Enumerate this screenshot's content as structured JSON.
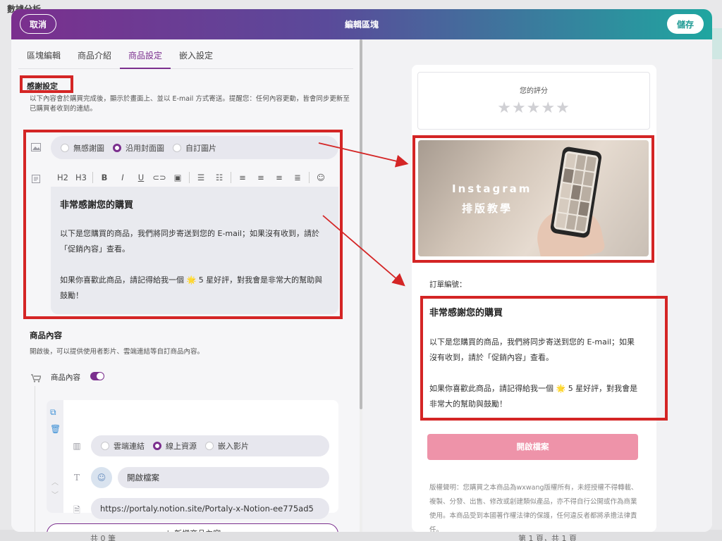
{
  "background": {
    "title": "數據分析",
    "count": "共 0 筆",
    "pager": "第 1 頁，共 1 頁"
  },
  "header": {
    "cancel": "取消",
    "title": "編輯區塊",
    "save": "儲存"
  },
  "tabs": [
    "區塊編輯",
    "商品介紹",
    "商品設定",
    "嵌入設定"
  ],
  "active_tab": "商品設定",
  "thanks": {
    "title": "感謝設定",
    "desc": "以下內容會於購買完成後，顯示於畫面上、並以 E-mail 方式寄送。提醒您：任何內容更動，皆會同步更新至已購買者收到的連結。",
    "image_options": [
      "無感謝圖",
      "沿用封面圖",
      "自訂圖片"
    ],
    "image_selected": "沿用封面圖",
    "toolbar": [
      "H2",
      "H3",
      "B",
      "I",
      "U",
      "link-icon",
      "image-icon",
      "bullet-list-icon",
      "ordered-list-icon",
      "align-left-icon",
      "align-center-icon",
      "align-right-icon",
      "align-justify-icon",
      "emoji-icon"
    ],
    "editor": {
      "heading": "非常感謝您的購買",
      "para1": "以下是您購買的商品，我們將同步寄送到您的 E-mail；如果沒有收到，請於「促銷內容」查看。",
      "para2": "如果你喜歡此商品，請記得給我一個 🌟 5 星好評，對我會是非常大的幫助與鼓勵！"
    }
  },
  "product_content": {
    "title": "商品內容",
    "desc": "開啟後，可以提供使用者影片、雲端連結等自訂商品內容。",
    "toggle_label": "商品內容",
    "toggle_on": true,
    "source_options": [
      "雲端連結",
      "線上資源",
      "嵌入影片"
    ],
    "source_selected": "線上資源",
    "button_text": "開啟檔案",
    "url": "https://portaly.notion.site/Portaly-x-Notion-ee775ad5",
    "add_button": "＋  新增商品內容"
  },
  "preview": {
    "rating_label": "您的評分",
    "stars": "★★★★★",
    "image_text_1": "Instagram",
    "image_text_2": "排版教學",
    "order_label": "訂單編號：",
    "heading": "非常感謝您的購買",
    "para1": "以下是您購買的商品，我們將同步寄送到您的 E-mail；如果沒有收到，請於「促銷內容」查看。",
    "para2": "如果你喜歡此商品，請記得給我一個 🌟 5 星好評，對我會是非常大的幫助與鼓勵！",
    "open_button": "開啟檔案",
    "copyright": "版權聲明：您購買之本商品為wxwang版權所有，未經授權不得轉載、複製、分發、出售、修改或創建類似產品，亦不得自行公開或作為商業使用。本商品受到本國著作權法律的保護，任何違反者都將承擔法律責任。"
  },
  "colors": {
    "brand_purple": "#7b2f8e",
    "brand_teal": "#1fa6a0",
    "annotation_red": "#d42525",
    "open_button_pink": "#ee93a9"
  }
}
